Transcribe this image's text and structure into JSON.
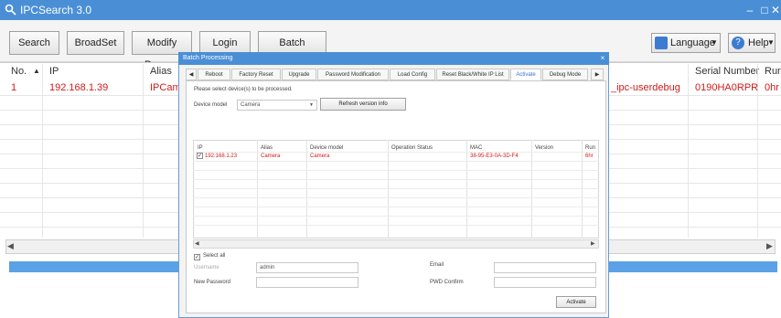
{
  "app": {
    "title": "IPCSearch 3.0"
  },
  "window_controls": {
    "minimize": "–",
    "maximize": "□",
    "close": "✕"
  },
  "toolbar": {
    "search": "Search",
    "broadset": "BroadSet",
    "modify_params": "Modify Params",
    "login": "Login",
    "batch_processing": "Batch Processing",
    "language": "Language",
    "help": "Help"
  },
  "grid": {
    "headers": {
      "no": "No.",
      "sort_arrow": "▲",
      "ip": "IP",
      "alias": "Alias",
      "device_name": "_ipc-userdebug",
      "serial": "Serial Number",
      "run": "Run"
    },
    "row": {
      "no": "1",
      "ip": "192.168.1.39",
      "alias": "IPCam",
      "device_name": "_ipc-userdebug",
      "serial": "0190HA0RPR",
      "run": "0hr"
    },
    "scroll_left": "◀",
    "scroll_right": "▶"
  },
  "dialog": {
    "title": "Batch Processing",
    "close": "×",
    "tab_scroll_left": "◀",
    "tab_scroll_right": "▶",
    "tabs": [
      "Reboot",
      "Factory Reset",
      "Upgrade",
      "Password Modification",
      "Load Config",
      "Reset Black/White IP List",
      "Activate",
      "Debug Mode"
    ],
    "instruction": "Please select device(s) to be processed.",
    "device_model_label": "Device model",
    "device_model_value": "Camera",
    "refresh_button": "Refresh version info",
    "table_headers": [
      "IP",
      "Alias",
      "Device model",
      "Operation Status",
      "MAC",
      "Version",
      "Run"
    ],
    "table_row": {
      "ip": "192.168.1.23",
      "alias": "Camera",
      "model": "Camera",
      "status": "",
      "mac": "38-95-E3-0A-3D-F4",
      "version": "",
      "run": "6hr"
    },
    "select_all": "Select all",
    "username_label": "Username",
    "username_value": "admin",
    "email_label": "Email",
    "new_password_label": "New Password",
    "pwd_confirm_label": "PWD Confirm",
    "activate_button": "Activate"
  },
  "colors": {
    "accent": "#4a8fd6",
    "selected_text": "#d11a1a",
    "active_tab": "#3b6fd0"
  }
}
